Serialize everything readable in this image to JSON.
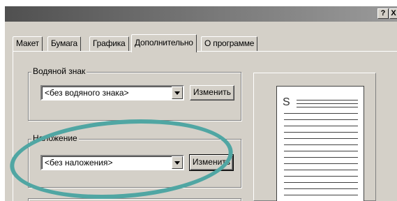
{
  "window": {
    "help_button": "?",
    "close_button": "X"
  },
  "tabs": [
    {
      "label": "Макет",
      "active": false
    },
    {
      "label": "Бумага",
      "active": false
    },
    {
      "label": "Графика",
      "active": false
    },
    {
      "label": "Дополнительно",
      "active": true
    },
    {
      "label": "О программе",
      "active": false
    }
  ],
  "watermark": {
    "group_label": "Водяной знак",
    "selected_value": "<без водяного знака>",
    "edit_button": "Изменить"
  },
  "overlay": {
    "group_label": "Наложение",
    "selected_value": "<без наложения>",
    "edit_button": "Изменить"
  },
  "preview": {
    "page_letter": "S"
  },
  "colors": {
    "dialog_background": "#d4d0c8",
    "highlight_ring": "#50a6a3"
  }
}
